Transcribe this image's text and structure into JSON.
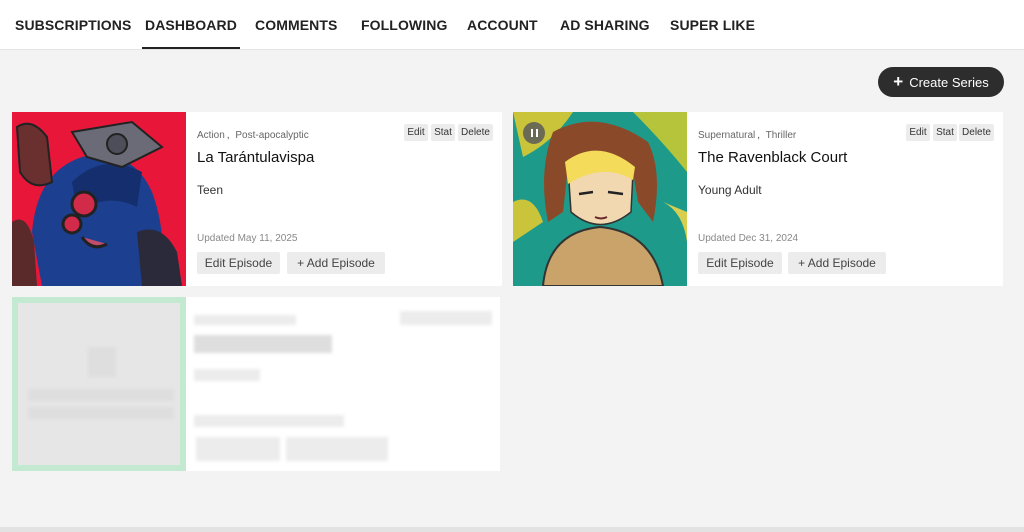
{
  "nav": {
    "tabs": [
      {
        "label": "SUBSCRIPTIONS"
      },
      {
        "label": "DASHBOARD"
      },
      {
        "label": "COMMENTS"
      },
      {
        "label": "FOLLOWING"
      },
      {
        "label": "ACCOUNT"
      },
      {
        "label": "AD SHARING"
      },
      {
        "label": "SUPER LIKE"
      }
    ],
    "active": "DASHBOARD"
  },
  "create_series": {
    "label": "Create Series",
    "icon": "plus-icon"
  },
  "series": [
    {
      "genres": [
        "Action",
        "Post-apocalyptic"
      ],
      "title": "La Tarántulavispa",
      "rating": "Teen",
      "updated": "Updated May 11, 2025",
      "actions": {
        "edit": "Edit",
        "stat": "Stat",
        "delete": "Delete"
      },
      "edit_episode": "Edit Episode",
      "add_episode": "+ Add Episode",
      "paused": false
    },
    {
      "genres": [
        "Supernatural",
        "Thriller"
      ],
      "title": "The Ravenblack Court",
      "rating": "Young Adult",
      "updated": "Updated Dec 31, 2024",
      "actions": {
        "edit": "Edit",
        "stat": "Stat",
        "delete": "Delete"
      },
      "edit_episode": "Edit Episode",
      "add_episode": "+ Add Episode",
      "paused": true
    }
  ],
  "colors": {
    "accent_dark": "#2d2d2d",
    "placeholder_border": "#c3ead0",
    "cover1_bg": "#e8173a",
    "cover2_bg": "#1e9a8a"
  }
}
